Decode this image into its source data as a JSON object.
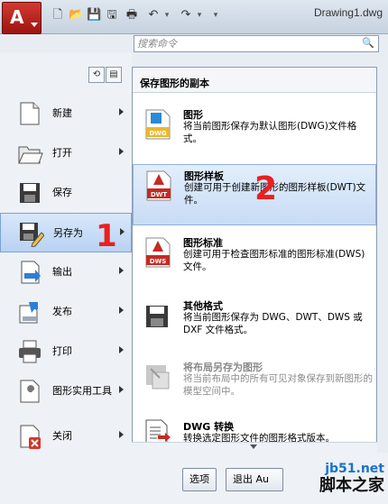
{
  "app": {
    "logo": "A",
    "document_title": "Drawing1.dwg"
  },
  "quick_access": {
    "icons": [
      "new-icon",
      "open-icon",
      "save-icon",
      "save-as-icon",
      "plot-icon",
      "undo-icon",
      "dropdown-icon",
      "redo-icon",
      "dropdown-icon",
      "customize-icon"
    ]
  },
  "search": {
    "placeholder": "搜索命令"
  },
  "menu": {
    "items": [
      {
        "label": "新建",
        "icon": "new-icon",
        "has_submenu": true
      },
      {
        "label": "打开",
        "icon": "open-folder-icon",
        "has_submenu": true
      },
      {
        "label": "保存",
        "icon": "save-icon",
        "has_submenu": false
      },
      {
        "label": "另存为",
        "icon": "save-as-icon",
        "has_submenu": true,
        "selected": true
      },
      {
        "label": "输出",
        "icon": "export-icon",
        "has_submenu": true
      },
      {
        "label": "发布",
        "icon": "publish-icon",
        "has_submenu": true
      },
      {
        "label": "打印",
        "icon": "print-icon",
        "has_submenu": true
      },
      {
        "label": "图形实用工具",
        "icon": "wrench-icon",
        "has_submenu": true
      },
      {
        "label": "关闭",
        "icon": "close-document-icon",
        "has_submenu": true
      }
    ]
  },
  "submenu": {
    "header": "保存图形的副本",
    "items": [
      {
        "title": "图形",
        "desc": "将当前图形保存为默认图形(DWG)文件格式。",
        "icon": "dwg-file-icon",
        "badge": "DWG"
      },
      {
        "title": "图形样板",
        "desc": "创建可用于创建新图形的图形样板(DWT)文件。",
        "icon": "dwt-file-icon",
        "badge": "DWT",
        "selected": true
      },
      {
        "title": "图形标准",
        "desc": "创建可用于检查图形标准的图形标准(DWS)文件。",
        "icon": "dws-file-icon",
        "badge": "DWS"
      },
      {
        "title": "其他格式",
        "desc": "将当前图形保存为 DWG、DWT、DWS 或 DXF 文件格式。",
        "icon": "save-other-icon"
      },
      {
        "title": "将布局另存为图形",
        "desc": "将当前布局中的所有可见对象保存到新图形的模型空间中。",
        "icon": "save-layout-icon",
        "disabled": true
      },
      {
        "title": "DWG 转换",
        "desc": "转换选定图形文件的图形格式版本。",
        "icon": "dwg-convert-icon"
      }
    ]
  },
  "annotations": {
    "one": "1",
    "two": "2"
  },
  "buttons": {
    "options": "选项",
    "exit": "退出 Au"
  },
  "watermark": {
    "url": "jb51.net",
    "site": "脚本之家"
  },
  "colors": {
    "accent_red": "#c62a22",
    "selection": "#c9dcf5",
    "annotation": "#e82020"
  }
}
